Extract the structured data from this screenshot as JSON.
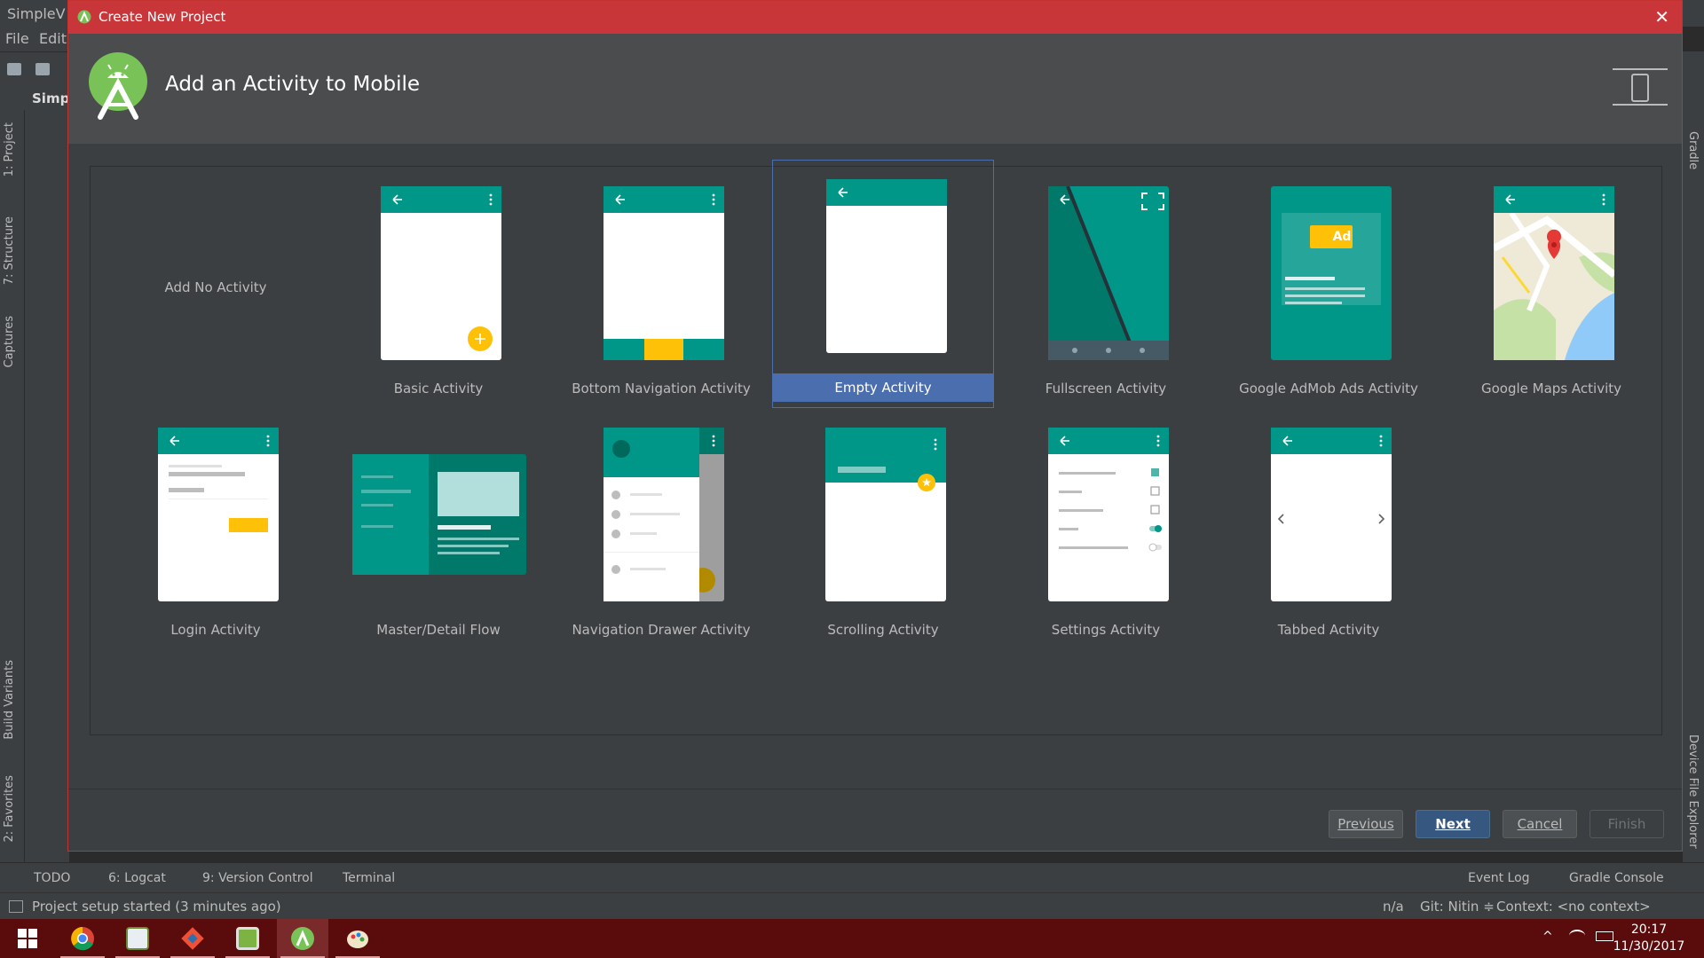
{
  "ide": {
    "app_title": "SimpleV",
    "menu": [
      "File",
      "Edit"
    ],
    "project_name": "Simpl",
    "left_tabs": [
      "1: Project",
      "7: Structure",
      "Captures",
      "Build Variants",
      "2: Favorites"
    ],
    "right_tabs": [
      "Gradle",
      "Device File Explorer"
    ],
    "bottom_tools": [
      "TODO",
      "6: Logcat",
      "9: Version Control",
      "Terminal",
      "Event Log",
      "Gradle Console"
    ],
    "status": {
      "message": "Project setup started (3 minutes ago)",
      "position": "n/a",
      "git": "Git: Nitin ≑",
      "context": "Context: <no context>"
    }
  },
  "dialog": {
    "title": "Create New Project",
    "header": "Add an Activity to Mobile",
    "activities": [
      "Add No Activity",
      "Basic Activity",
      "Bottom Navigation Activity",
      "Empty Activity",
      "Fullscreen Activity",
      "Google AdMob Ads Activity",
      "Google Maps Activity",
      "Login Activity",
      "Master/Detail Flow",
      "Navigation Drawer Activity",
      "Scrolling Activity",
      "Settings Activity",
      "Tabbed Activity"
    ],
    "selected": "Empty Activity",
    "ad_badge": "Ad",
    "buttons": {
      "previous": "Previous",
      "next": "Next",
      "cancel": "Cancel",
      "finish": "Finish"
    }
  },
  "taskbar": {
    "time": "20:17",
    "date": "11/30/2017"
  },
  "colors": {
    "teal": "#009688",
    "teal_dark": "#00796b",
    "amber": "#ffc107",
    "selection": "#4b6eaf",
    "title_red": "#c8363a"
  }
}
